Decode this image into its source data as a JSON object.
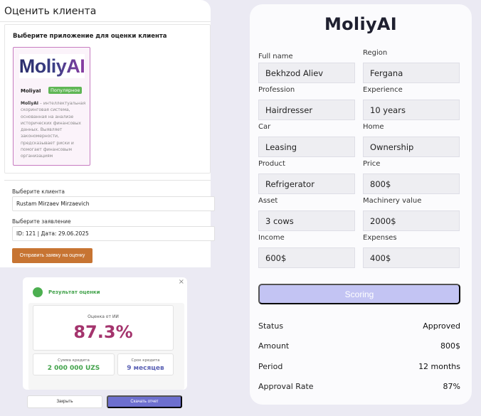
{
  "evaluate_panel": {
    "title": "Оценить клиента",
    "select_app_label": "Выберите приложение для оценки клиента",
    "app_card": {
      "logo_text": "MoliyAI",
      "name": "MoliyaI",
      "badge": "Популярное",
      "desc_bold": "MoliyAI",
      "desc_rest": " – интеллектуальная скоринговая система, основанная на анализе исторических финансовых данных. Выявляет закономерности, предсказывает риски и помогает финансовым организациям"
    },
    "client_label": "Выберите клиента",
    "client_value": "Rustam Mirzaev Mirzaevich",
    "application_label": "Выберите заявление",
    "application_value": "ID: 121 | Дата: 29.06.2025",
    "submit_label": "Отправить заявку на оценку"
  },
  "result_modal": {
    "close_icon": "×",
    "title": "Результат оценки",
    "score_label": "Оценка от ИИ",
    "score_value": "87.3%",
    "sum_label": "Сумма кредита",
    "sum_value": "2 000 000 UZS",
    "term_label": "Срок кредита",
    "term_value": "9 месяцев",
    "close_button": "Закрыть",
    "download_button": "Скачать отчет"
  },
  "moliy_form": {
    "brand": "MoliyAI",
    "fields": {
      "full_name": {
        "label": "Full name",
        "value": "Bekhzod Aliev"
      },
      "region": {
        "label": "Region",
        "value": "Fergana"
      },
      "profession": {
        "label": "Profession",
        "value": "Hairdresser"
      },
      "experience": {
        "label": "Experience",
        "value": "10 years"
      },
      "car": {
        "label": "Car",
        "value": "Leasing"
      },
      "home": {
        "label": "Home",
        "value": "Ownership"
      },
      "product": {
        "label": "Product",
        "value": "Refrigerator"
      },
      "price": {
        "label": "Price",
        "value": "800$"
      },
      "asset": {
        "label": "Asset",
        "value": "3 cows"
      },
      "machinery": {
        "label": "Machinery value",
        "value": "2000$"
      },
      "income": {
        "label": "Income",
        "value": "600$"
      },
      "expenses": {
        "label": "Expenses",
        "value": "400$"
      }
    },
    "scoring_button": "Scoring",
    "results": {
      "status": {
        "label": "Status",
        "value": "Approved"
      },
      "amount": {
        "label": "Amount",
        "value": "800$"
      },
      "period": {
        "label": "Period",
        "value": "12 months"
      },
      "approval_rate": {
        "label": "Approval Rate",
        "value": "87%"
      }
    }
  },
  "colors": {
    "submit": "#c77432",
    "score": "#a4346d",
    "success": "#41a24a",
    "accent": "#6d6fcf",
    "scoring_button": "#c3c4f3"
  }
}
